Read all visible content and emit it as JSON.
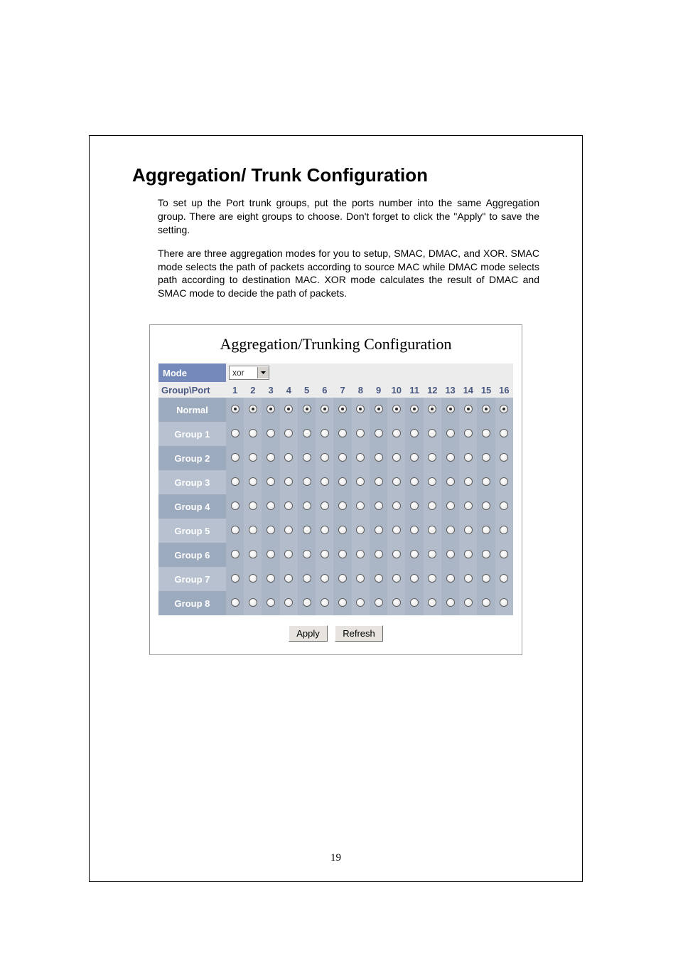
{
  "section": {
    "title": "Aggregation/ Trunk Configuration",
    "para1": "To set up the Port trunk groups, put the ports number into the same Aggregation group. There are eight groups to choose. Don't forget to click the \"Apply\" to save the setting.",
    "para2": "There are three aggregation modes for you to setup, SMAC, DMAC, and XOR. SMAC mode selects the path of packets according to source MAC while DMAC mode selects path according to destination MAC. XOR mode calculates the result of DMAC and SMAC mode to decide the path of packets."
  },
  "panel": {
    "title": "Aggregation/Trunking Configuration",
    "mode_label": "Mode",
    "mode_value": "xor",
    "group_port_header": "Group\\Port",
    "ports": [
      "1",
      "2",
      "3",
      "4",
      "5",
      "6",
      "7",
      "8",
      "9",
      "10",
      "11",
      "12",
      "13",
      "14",
      "15",
      "16"
    ],
    "rows": [
      {
        "label": "Normal",
        "selected": true
      },
      {
        "label": "Group 1",
        "selected": false
      },
      {
        "label": "Group 2",
        "selected": false
      },
      {
        "label": "Group 3",
        "selected": false
      },
      {
        "label": "Group 4",
        "selected": false
      },
      {
        "label": "Group 5",
        "selected": false
      },
      {
        "label": "Group 6",
        "selected": false
      },
      {
        "label": "Group 7",
        "selected": false
      },
      {
        "label": "Group 8",
        "selected": false
      }
    ],
    "apply_label": "Apply",
    "refresh_label": "Refresh"
  },
  "page_number": "19"
}
